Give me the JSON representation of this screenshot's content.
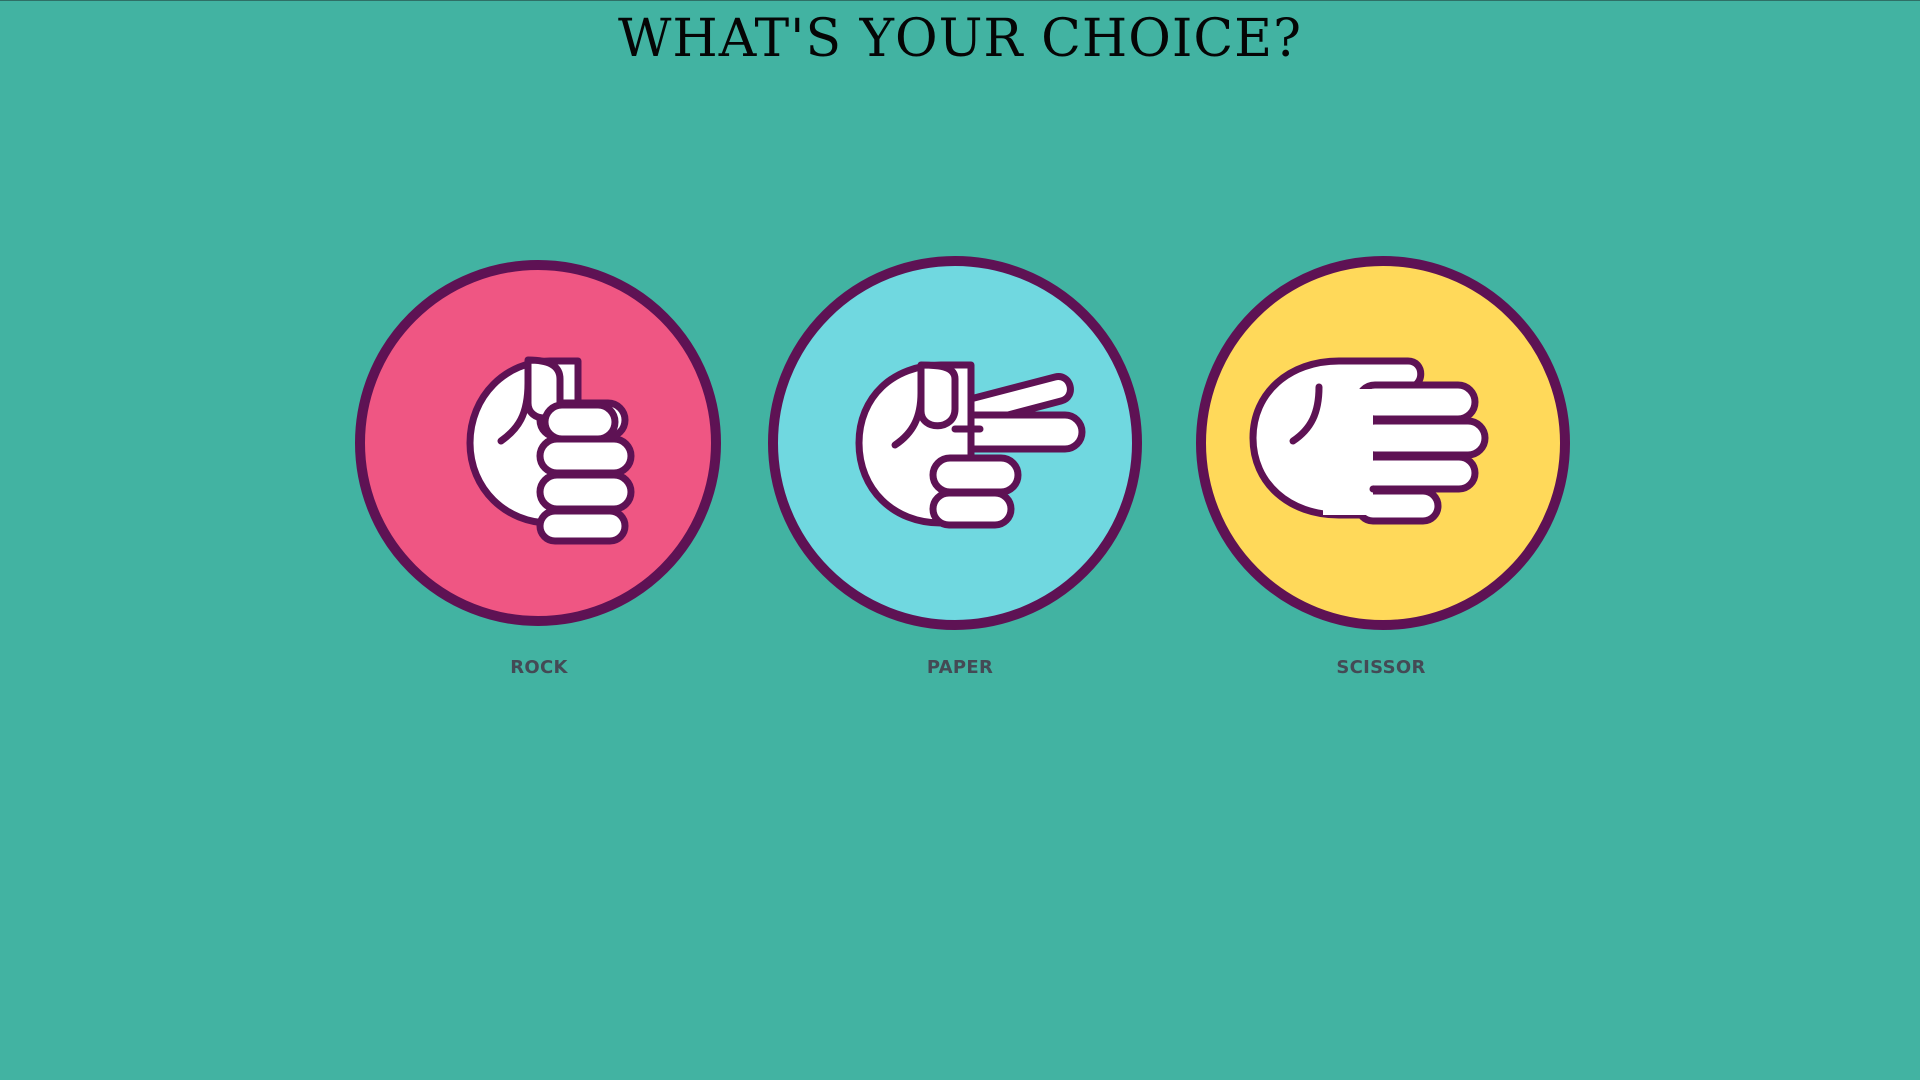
{
  "title": "WHAT'S YOUR CHOICE?",
  "colors": {
    "background": "#42b3a2",
    "outline": "#5e1254",
    "rock": "#ef5683",
    "paper": "#70d8e0",
    "scissor": "#ffd95a",
    "hand": "#ffffff",
    "label": "#444a55"
  },
  "choices": [
    {
      "id": "rock",
      "label": "ROCK",
      "icon": "fist-hand-icon"
    },
    {
      "id": "paper",
      "label": "PAPER",
      "icon": "two-fingers-hand-icon"
    },
    {
      "id": "scissor",
      "label": "SCISSOR",
      "icon": "flat-hand-icon"
    }
  ]
}
